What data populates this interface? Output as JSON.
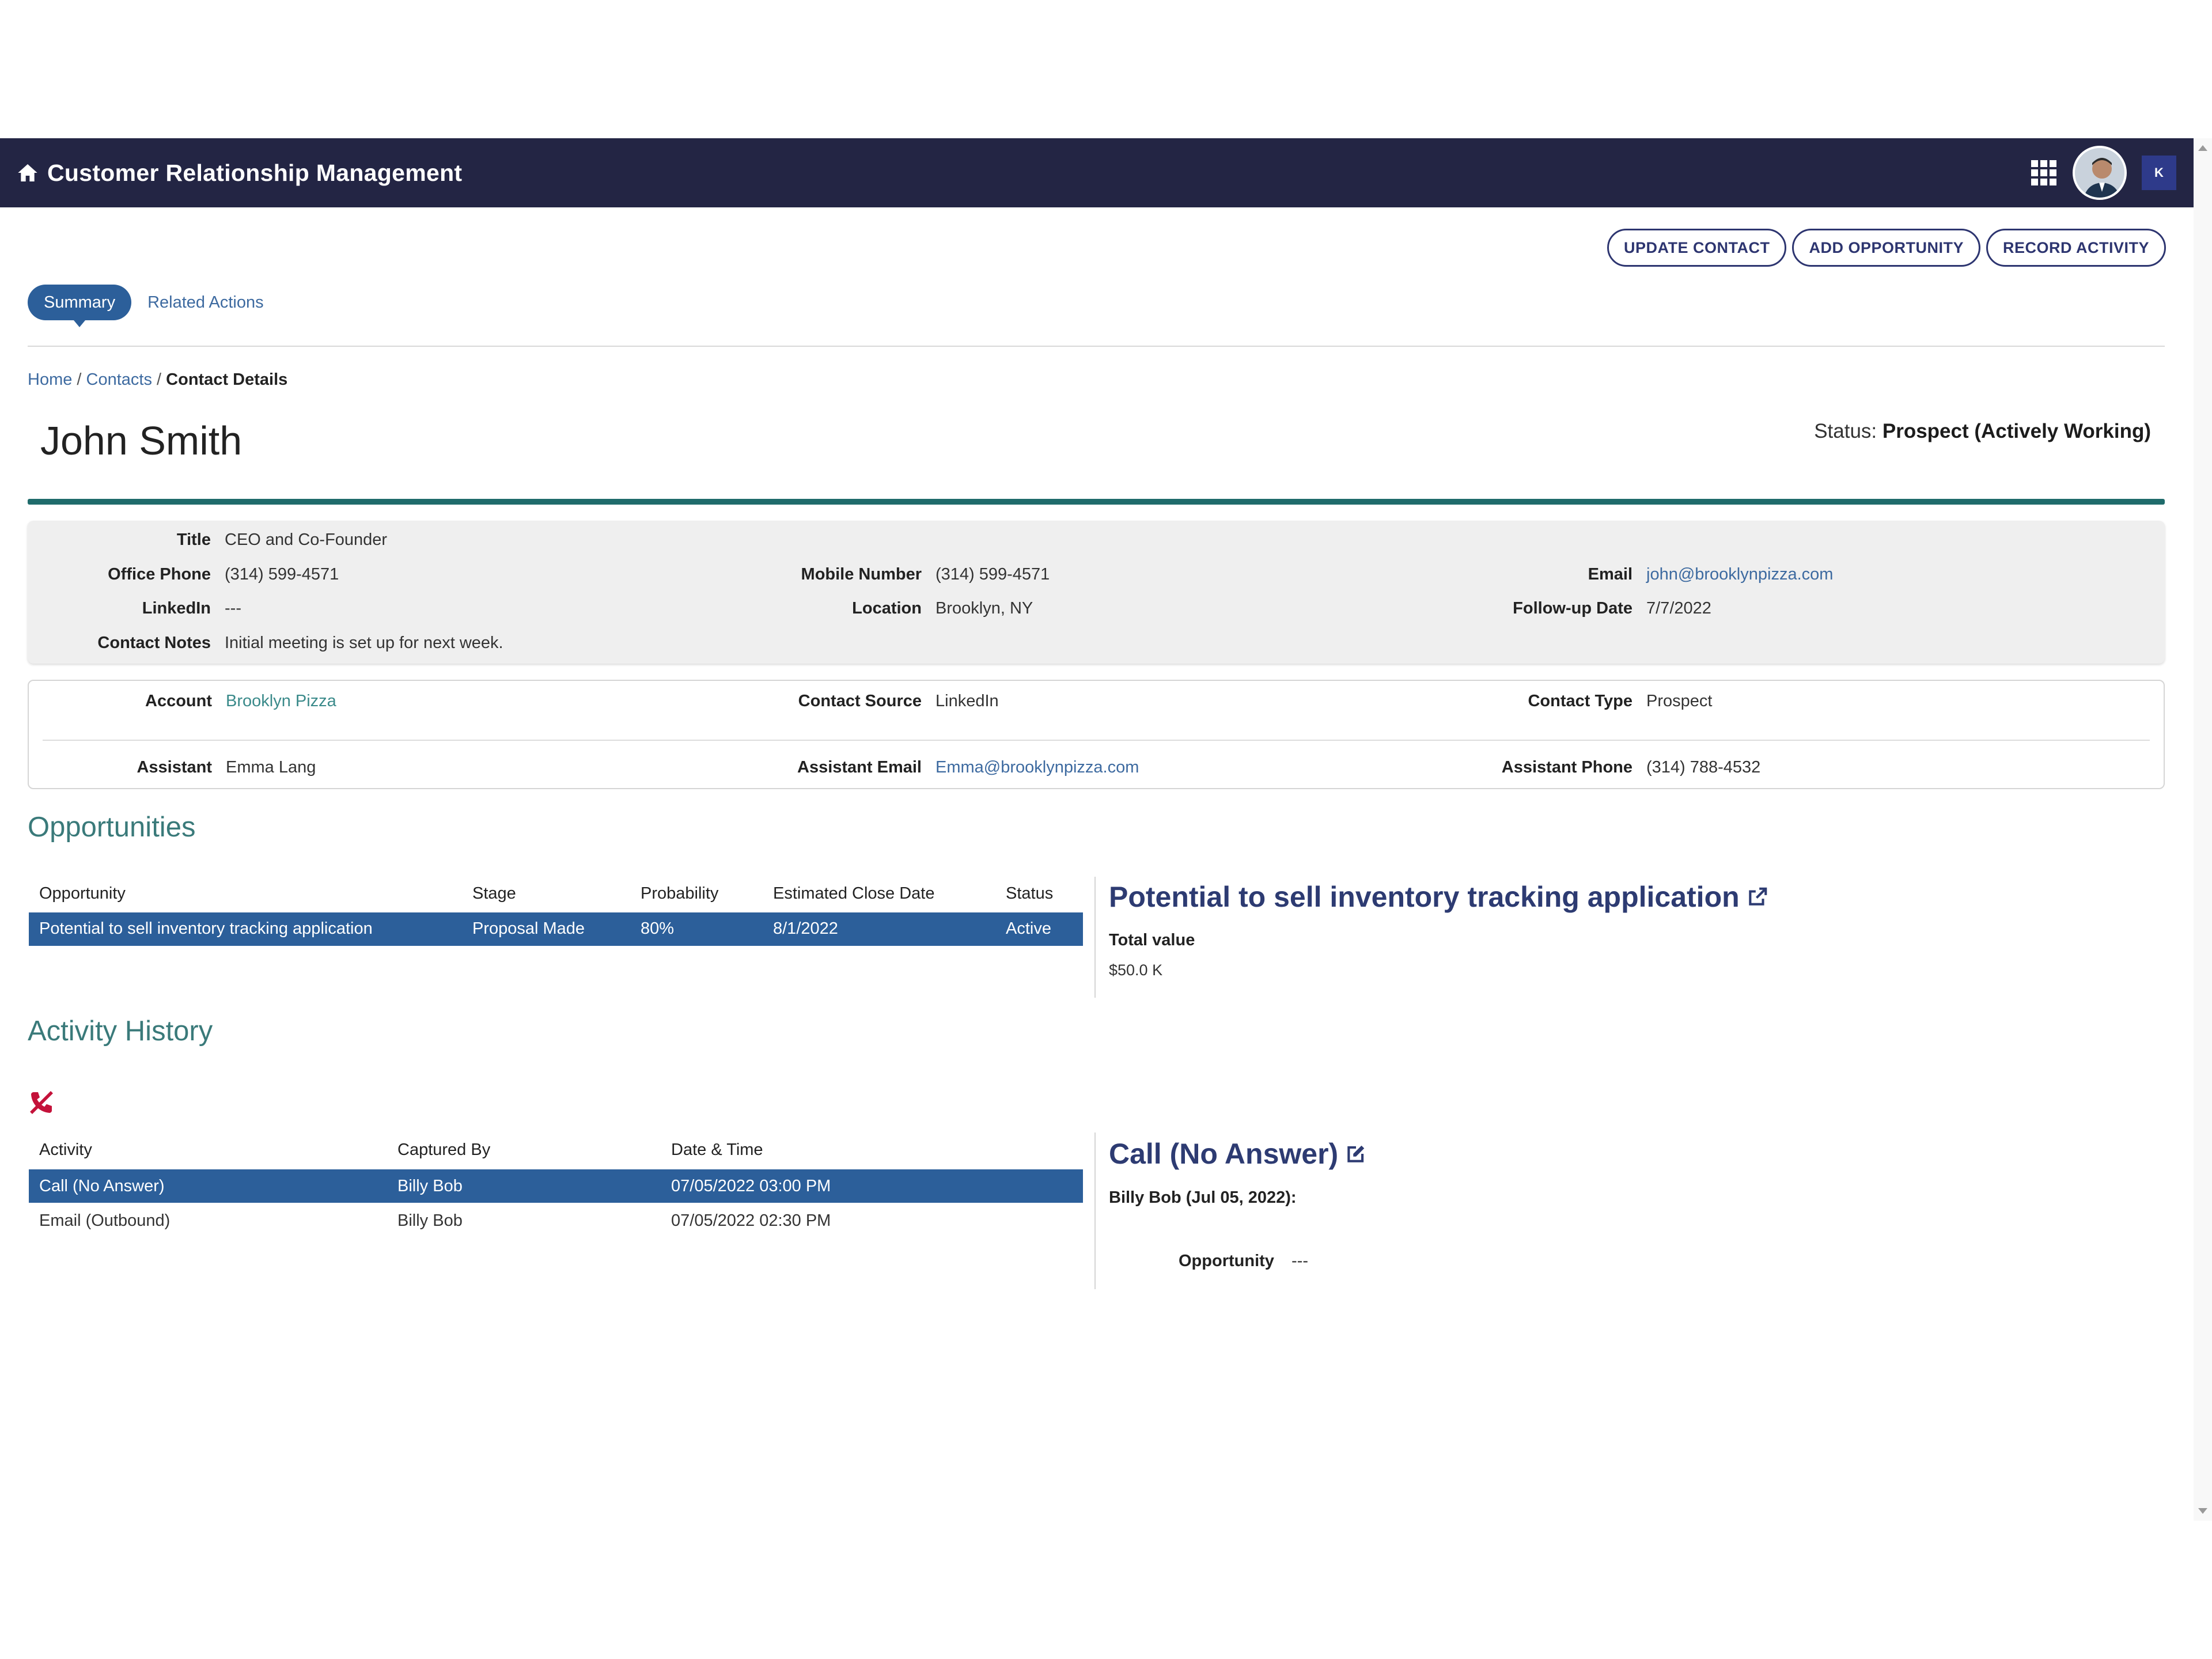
{
  "header": {
    "app_title": "Customer Relationship Management",
    "icons": [
      "home-icon",
      "apps-grid-icon",
      "user-avatar",
      "brand-logo"
    ]
  },
  "toolbar": {
    "update_contact": "UPDATE CONTACT",
    "add_opportunity": "ADD OPPORTUNITY",
    "record_activity": "RECORD ACTIVITY"
  },
  "tabs": {
    "summary": "Summary",
    "related_actions": "Related Actions"
  },
  "breadcrumb": {
    "home": "Home",
    "sep1": " / ",
    "contacts": "Contacts",
    "sep2": " / ",
    "current": "Contact Details"
  },
  "contact": {
    "name": "John Smith",
    "status_label": "Status: ",
    "status_value": "Prospect (Actively Working)"
  },
  "details": {
    "title_label": "Title",
    "title_value": "CEO and Co-Founder",
    "office_phone_label": "Office Phone",
    "office_phone_value": "(314) 599-4571",
    "mobile_label": "Mobile Number",
    "mobile_value": "(314) 599-4571",
    "email_label": "Email",
    "email_value": "john@brooklynpizza.com",
    "linkedin_label": "LinkedIn",
    "linkedin_value": "---",
    "location_label": "Location",
    "location_value": "Brooklyn, NY",
    "followup_label": "Follow-up Date",
    "followup_value": "7/7/2022",
    "notes_label": "Contact Notes",
    "notes_value": "Initial meeting is set up for next week."
  },
  "account": {
    "account_label": "Account",
    "account_value": "Brooklyn Pizza",
    "source_label": "Contact Source",
    "source_value": "LinkedIn",
    "type_label": "Contact Type",
    "type_value": "Prospect",
    "assistant_label": "Assistant",
    "assistant_value": "Emma Lang",
    "assistant_email_label": "Assistant Email",
    "assistant_email_value": "Emma@brooklynpizza.com",
    "assistant_phone_label": "Assistant Phone",
    "assistant_phone_value": "(314) 788-4532"
  },
  "opportunities": {
    "section_title": "Opportunities",
    "columns": [
      "Opportunity",
      "Stage",
      "Probability",
      "Estimated Close Date",
      "Status"
    ],
    "rows": [
      [
        "Potential to sell inventory tracking application",
        "Proposal Made",
        "80%",
        "8/1/2022",
        "Active"
      ]
    ],
    "detail": {
      "title": "Potential to sell inventory tracking application",
      "total_value_label": "Total value",
      "total_value": "$50.0 K"
    }
  },
  "activity": {
    "section_title": "Activity History",
    "filter_icon": "missed-call-icon",
    "columns": [
      "Activity",
      "Captured By",
      "Date & Time"
    ],
    "rows": [
      [
        "Call (No Answer)",
        "Billy Bob",
        "07/05/2022 03:00 PM"
      ],
      [
        "Email (Outbound)",
        "Billy Bob",
        "07/05/2022 02:30 PM"
      ]
    ],
    "detail": {
      "title": "Call (No Answer)",
      "captured": "Billy Bob (Jul 05, 2022):",
      "opportunity_label": "Opportunity",
      "opportunity_value": "---"
    }
  },
  "colors": {
    "header_bg": "#232544",
    "accent_blue": "#2c5f9a",
    "teal": "#1f6b6b",
    "title_navy": "#2d3b72",
    "missed_call_red": "#c4123a"
  }
}
